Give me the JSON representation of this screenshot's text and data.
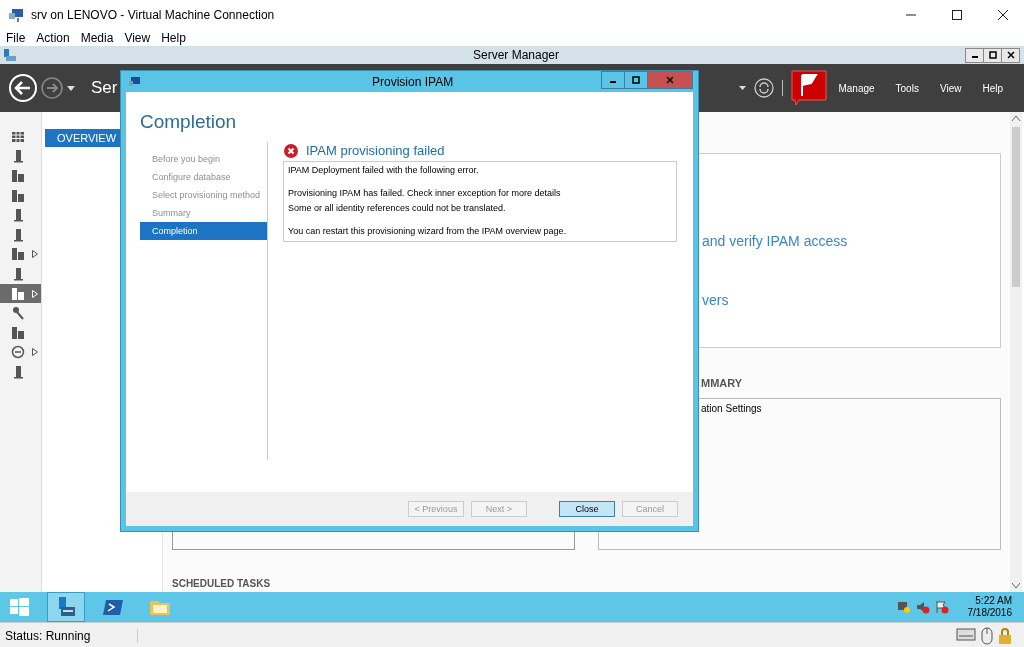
{
  "vm_window": {
    "title": "srv on LENOVO - Virtual Machine Connection",
    "menu": [
      "File",
      "Action",
      "Media",
      "View",
      "Help"
    ]
  },
  "server_manager": {
    "title": "Server Manager",
    "header_title": "Ser",
    "header_menu": [
      "Manage",
      "Tools",
      "View",
      "Help"
    ],
    "sidebar": {
      "items": [
        {
          "kind": "grid",
          "selected": false,
          "expandable": false
        },
        {
          "kind": "server",
          "selected": false,
          "expandable": false
        },
        {
          "kind": "servers",
          "selected": false,
          "expandable": false
        },
        {
          "kind": "servers",
          "selected": false,
          "expandable": false
        },
        {
          "kind": "server",
          "selected": false,
          "expandable": false
        },
        {
          "kind": "server",
          "selected": false,
          "expandable": false
        },
        {
          "kind": "servers",
          "selected": false,
          "expandable": true
        },
        {
          "kind": "server",
          "selected": false,
          "expandable": false
        },
        {
          "kind": "servers",
          "selected": true,
          "expandable": true
        },
        {
          "kind": "key",
          "selected": false,
          "expandable": false
        },
        {
          "kind": "servers",
          "selected": false,
          "expandable": false
        },
        {
          "kind": "circle",
          "selected": false,
          "expandable": true
        },
        {
          "kind": "server",
          "selected": false,
          "expandable": false
        }
      ]
    },
    "nav": [
      {
        "label": "OVERVIEW",
        "selected": true
      }
    ],
    "content": {
      "links": [
        "and verify IPAM access",
        "vers"
      ],
      "section_heading": "MMARY",
      "summary_item": "ation Settings",
      "next_heading": "SCHEDULED TASKS"
    }
  },
  "dialog": {
    "title": "Provision IPAM",
    "heading": "Completion",
    "steps": [
      {
        "label": "Before you begin",
        "selected": false
      },
      {
        "label": "Configure database",
        "selected": false
      },
      {
        "label": "Select provisioning method",
        "selected": false
      },
      {
        "label": "Summary",
        "selected": false
      },
      {
        "label": "Completion",
        "selected": true
      }
    ],
    "result_title": "IPAM provisioning failed",
    "messages": [
      [
        "IPAM Deployment failed with the following error."
      ],
      [
        "Provisioning IPAM has failed. Check inner exception for more details",
        "Some or all identity references could not be translated."
      ],
      [
        "You can restart this provisioning wizard from the IPAM overview page."
      ]
    ],
    "buttons": [
      {
        "label": "< Previous",
        "disabled": true,
        "default": false
      },
      {
        "label": "Next >",
        "disabled": true,
        "default": false
      },
      {
        "label": "Close",
        "disabled": false,
        "default": true
      },
      {
        "label": "Cancel",
        "disabled": true,
        "default": false
      }
    ]
  },
  "taskbar": {
    "apps": [
      {
        "kind": "start",
        "selected": false
      },
      {
        "kind": "server-manager",
        "selected": true
      },
      {
        "kind": "powershell",
        "selected": false
      },
      {
        "kind": "folder",
        "selected": false
      }
    ],
    "time": "5:22 AM",
    "date": "7/18/2016"
  },
  "status_bar": {
    "text": "Status: Running"
  }
}
